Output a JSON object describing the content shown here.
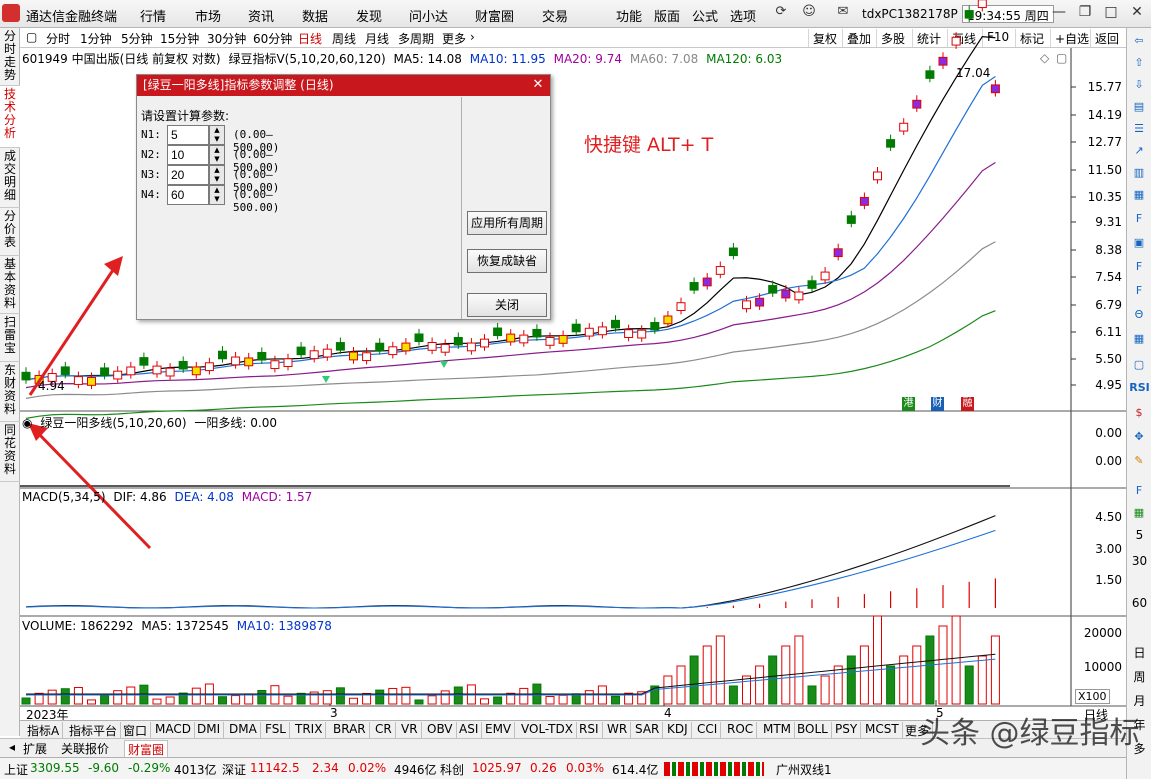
{
  "app": {
    "title": "通达信金融终端",
    "menu": [
      "行情",
      "市场",
      "资讯",
      "数据",
      "发现",
      "问小达",
      "财富圈",
      "交易",
      "功能",
      "版面",
      "公式",
      "选项"
    ],
    "account": "tdxPC1382178P",
    "clock": "19:34:55 周四"
  },
  "periods": [
    "分时",
    "1分钟",
    "5分钟",
    "15分钟",
    "30分钟",
    "60分钟",
    "日线",
    "周线",
    "月线",
    "多周期",
    "更多"
  ],
  "active_period": "日线",
  "toolbar": [
    "复权",
    "叠加",
    "多股",
    "统计",
    "画线",
    "F10",
    "标记",
    "+自选",
    "返回"
  ],
  "left_tabs": [
    "分时走势",
    "技术分析",
    "成交明细",
    "分价表",
    "基本资料",
    "扫雷宝",
    "东财资料",
    "同花资料"
  ],
  "active_left_tab": "技术分析",
  "right_bar": {
    "codes": [
      "RSI"
    ],
    "numbers": [
      "5",
      "30",
      "60"
    ],
    "period_labels": [
      "日",
      "周",
      "月",
      "年",
      "多"
    ]
  },
  "main_pane": {
    "stock": "601949 中国出版(日线 前复权 对数)",
    "indicator": "绿豆指标V(5,10,20,60,120)",
    "ma5": "MA5: 14.08",
    "ma10": "MA10: 11.95",
    "ma20": "MA20: 9.74",
    "ma60": "MA60: 7.08",
    "ma120": "MA120: 6.03",
    "high_label": "17.04",
    "low_label": "4.94",
    "axis": [
      "15.77",
      "14.19",
      "12.77",
      "11.50",
      "10.35",
      "9.31",
      "8.38",
      "7.54",
      "6.79",
      "6.11",
      "5.50",
      "4.95"
    ],
    "badges": [
      "港",
      "财",
      "融"
    ]
  },
  "pane2": {
    "name": "绿豆一阳多线(5,10,20,60)",
    "value": "一阳多线: 0.00",
    "axis": [
      "0.00",
      "0.00"
    ]
  },
  "macd_pane": {
    "name": "MACD(5,34,5)",
    "dif": "DIF: 4.86",
    "dea": "DEA: 4.08",
    "macd": "MACD: 1.57",
    "axis": [
      "4.50",
      "3.00",
      "1.50"
    ]
  },
  "volume_pane": {
    "name": "VOLUME: 1862292",
    "ma5": "MA5: 1372545",
    "ma10": "MA10: 1389878",
    "axis": [
      "20000",
      "10000"
    ],
    "unit": "X100"
  },
  "x_axis": {
    "year": "2023年",
    "months": [
      "3",
      "4",
      "5"
    ],
    "period_label": "日线"
  },
  "dialog": {
    "title": "[绿豆一阳多线]指标参数调整 (日线)",
    "prompt": "请设置计算参数:",
    "params": [
      {
        "label": "N1:",
        "value": "5",
        "range": "(0.00—500.00)"
      },
      {
        "label": "N2:",
        "value": "10",
        "range": "(0.00—500.00)"
      },
      {
        "label": "N3:",
        "value": "20",
        "range": "(0.00—500.00)"
      },
      {
        "label": "N4:",
        "value": "60",
        "range": "(0.00—500.00)"
      }
    ],
    "buttons": {
      "apply_all": "应用所有周期",
      "restore": "恢复成缺省",
      "close": "关闭"
    }
  },
  "hint": "快捷键 ALT+ T",
  "indicator_tabs": [
    "指标A",
    "指标平台",
    "窗口",
    "MACD",
    "DMI",
    "DMA",
    "FSL",
    "TRIX",
    "BRAR",
    "CR",
    "VR",
    "OBV",
    "ASI",
    "EMV",
    "VOL-TDX",
    "RSI",
    "WR",
    "SAR",
    "KDJ",
    "CCI",
    "ROC",
    "MTM",
    "BOLL",
    "PSY",
    "MCST",
    "更多"
  ],
  "sub_tabs": [
    "扩展",
    "关联报价",
    "财富圈"
  ],
  "status": {
    "sh_name": "上证",
    "sh_index": "3309.55",
    "sh_chg": "-9.60",
    "sh_pct": "-0.29%",
    "sh_amt": "4013亿",
    "sz_name": "深证",
    "sz_index": "11142.5",
    "sz_chg": "2.34",
    "sz_pct": "0.02%",
    "sz_amt": "4946亿",
    "kc_name": "科创",
    "kc_index": "1025.97",
    "kc_chg": "0.26",
    "kc_pct": "0.03%",
    "kc_amt": "614.4亿",
    "ticker": "广州双线1"
  },
  "watermark": "头条 @绿豆指标",
  "colors": {
    "up": "#e00000",
    "down": "#007a00",
    "ma5": "#000000",
    "ma10": "#1e6fd9",
    "ma20": "#8a1a8a",
    "ma60": "#8c8c8c",
    "ma120": "#1a8a1a",
    "accent": "#c8181e"
  }
}
